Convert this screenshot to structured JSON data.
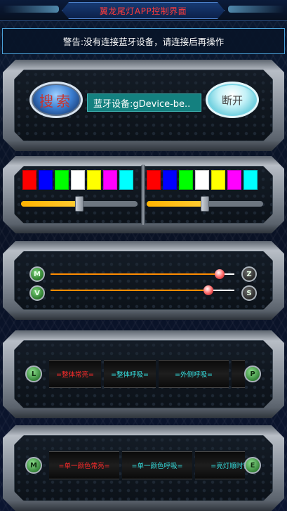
{
  "header": {
    "title": "翼龙尾灯APP控制界面"
  },
  "warning": {
    "text": "警告:没有连接蓝牙设备，请连接后再操作"
  },
  "connection": {
    "search_label": "搜索",
    "device_label": "蓝牙设备:gDevice-be..",
    "disconnect_label": "断开"
  },
  "colors": {
    "left_swatches": [
      "#ff0000",
      "#0000ff",
      "#00ff00",
      "#ffffff",
      "#ffff00",
      "#ff00ff",
      "#00ffff"
    ],
    "right_swatches": [
      "#ff0000",
      "#0000ff",
      "#00ff00",
      "#ffffff",
      "#ffff00",
      "#ff00ff",
      "#00ffff"
    ],
    "left_brightness_level": 0.5,
    "right_brightness_level": 0.5
  },
  "sliders": {
    "m_label": "M",
    "v_label": "V",
    "z_label": "Z",
    "s_label": "S",
    "m_level": 0.92,
    "v_level": 0.86
  },
  "modes_row1": {
    "left_icon": "L",
    "right_icon": "P",
    "items": [
      {
        "label": "=整体常亮=",
        "color": "#ff2a2a"
      },
      {
        "label": "=整体呼吸=",
        "color": "#35e0e0"
      },
      {
        "label": "=外侧呼吸=",
        "color": "#35e0e0"
      },
      {
        "label": "",
        "color": "#35e0e0"
      }
    ]
  },
  "modes_row2": {
    "left_icon": "M",
    "right_icon": "E",
    "items": [
      {
        "label": "=单一颜色常亮=",
        "color": "#ff2a2a"
      },
      {
        "label": "=单一颜色呼吸=",
        "color": "#35e0e0"
      },
      {
        "label": "=亮灯顺时针",
        "color": "#35e0e0"
      }
    ]
  }
}
